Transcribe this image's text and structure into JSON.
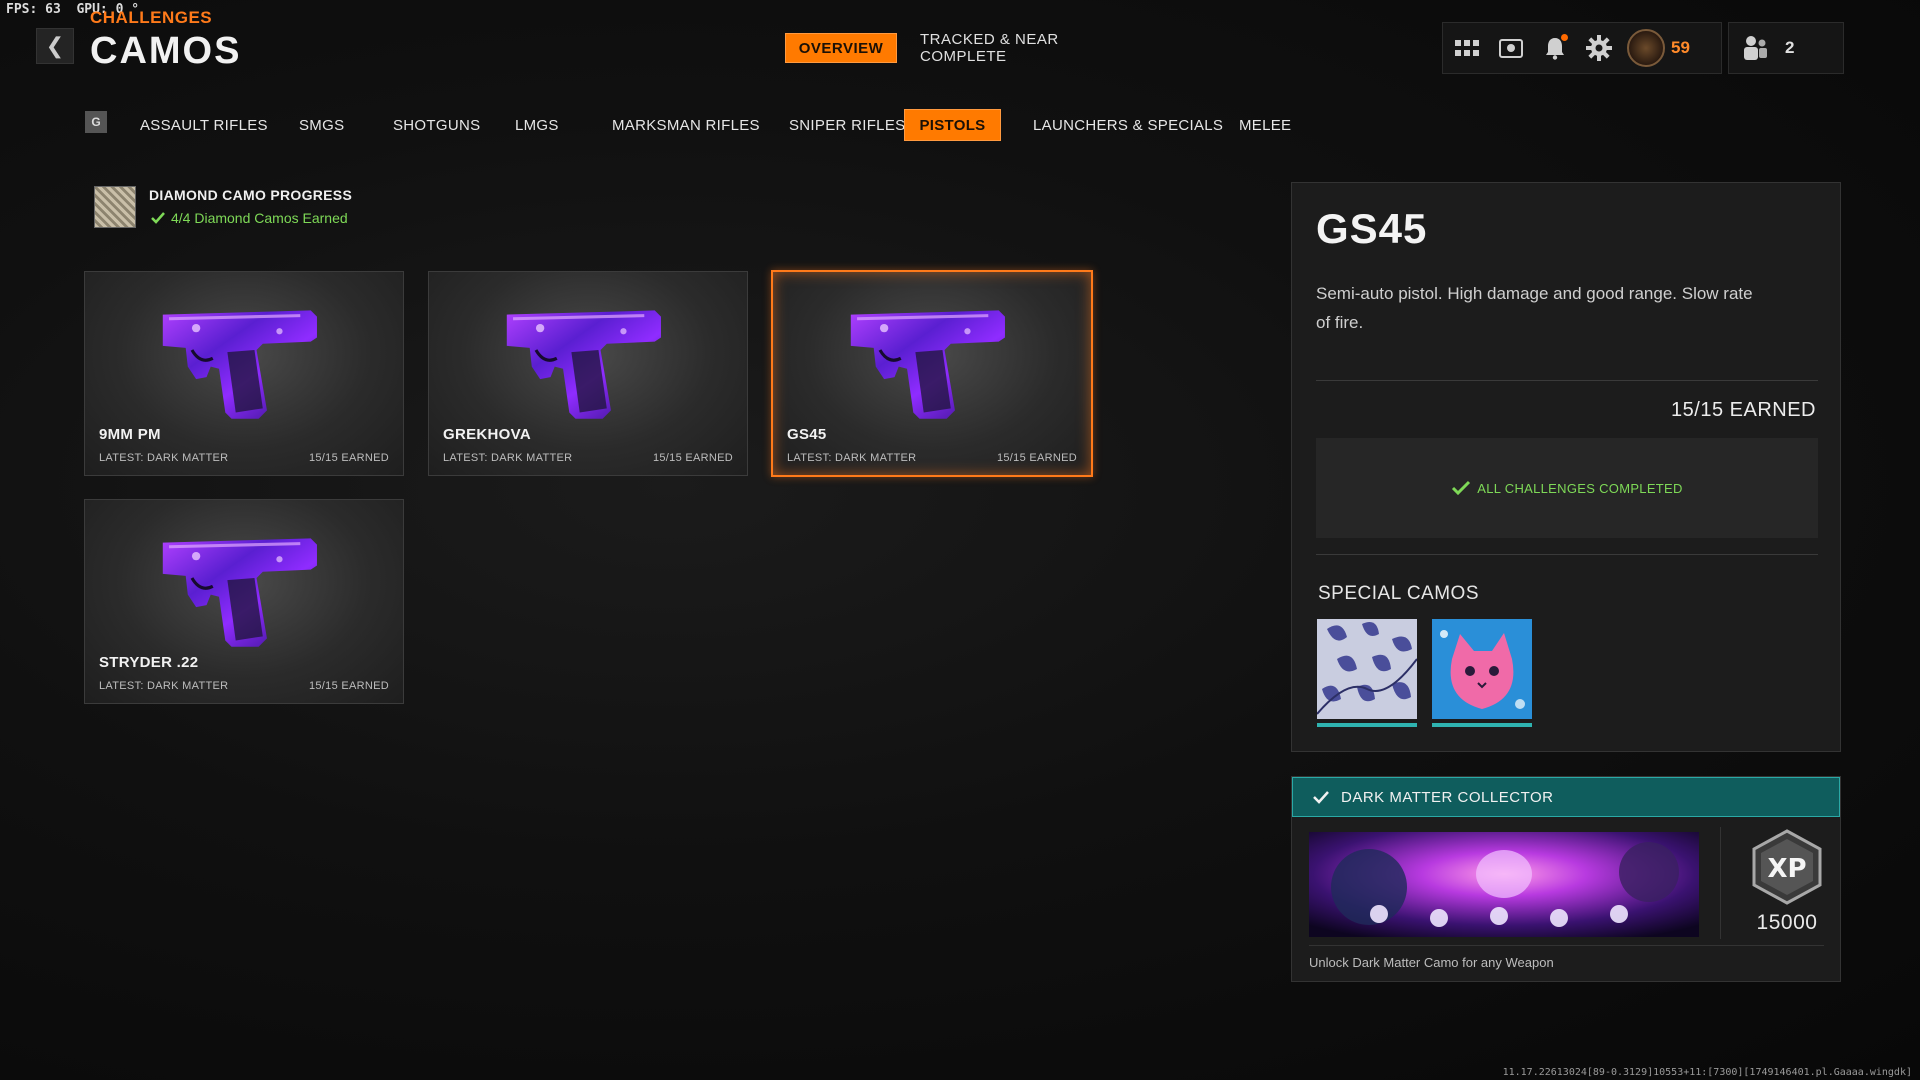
{
  "debug": {
    "fps_label": "FPS:",
    "fps_value": "63",
    "gpu_label": "GPU:",
    "gpu_value": "0 °"
  },
  "header": {
    "breadcrumb": "CHALLENGES",
    "title": "CAMOS",
    "tabs": [
      {
        "label": "OVERVIEW",
        "active": true
      },
      {
        "label": "TRACKED & NEAR COMPLETE",
        "active": false
      }
    ],
    "level": "59",
    "party_count": "2"
  },
  "categories": {
    "key_hint": "G",
    "items": [
      {
        "label": "ASSAULT RIFLES",
        "active": false
      },
      {
        "label": "SMGS",
        "active": false
      },
      {
        "label": "SHOTGUNS",
        "active": false
      },
      {
        "label": "LMGS",
        "active": false
      },
      {
        "label": "MARKSMAN RIFLES",
        "active": false
      },
      {
        "label": "SNIPER RIFLES",
        "active": false
      },
      {
        "label": "PISTOLS",
        "active": true
      },
      {
        "label": "LAUNCHERS & SPECIALS",
        "active": false
      },
      {
        "label": "MELEE",
        "active": false
      }
    ]
  },
  "diamond": {
    "title": "DIAMOND CAMO PROGRESS",
    "subtitle": "4/4 Diamond Camos Earned"
  },
  "weapons": [
    {
      "name": "9MM PM",
      "latest": "LATEST: DARK MATTER",
      "earned": "15/15 EARNED",
      "selected": false
    },
    {
      "name": "GREKHOVA",
      "latest": "LATEST: DARK MATTER",
      "earned": "15/15 EARNED",
      "selected": false
    },
    {
      "name": "GS45",
      "latest": "LATEST: DARK MATTER",
      "earned": "15/15 EARNED",
      "selected": true
    },
    {
      "name": "STRYDER .22",
      "latest": "LATEST: DARK MATTER",
      "earned": "15/15 EARNED",
      "selected": false
    }
  ],
  "detail": {
    "name": "GS45",
    "description": "Semi-auto pistol.  High damage and good range. Slow rate of fire.",
    "earned": "15/15 EARNED",
    "status": "ALL CHALLENGES COMPLETED",
    "special_title": "SPECIAL CAMOS"
  },
  "reward": {
    "title": "DARK MATTER COLLECTOR",
    "xp": "15000",
    "description": "Unlock Dark Matter Camo for any Weapon"
  },
  "build_string": "11.17.22613024[89-0.3129]10553+11:[7300][1749146401.pl.Gaaaa.wingdk]",
  "colors": {
    "accent": "#ff7a00",
    "success": "#7ed957",
    "teal": "#0f5d5d"
  }
}
